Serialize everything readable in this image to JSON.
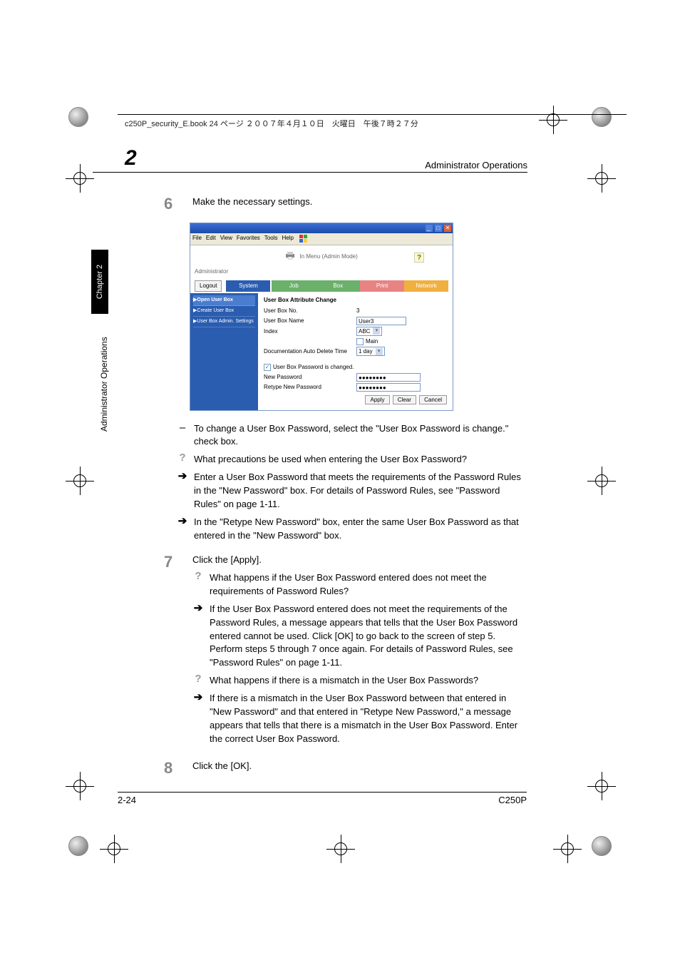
{
  "header_line": "c250P_security_E.book  24 ページ   ２００７年４月１０日　火曜日　午後７時２７分",
  "running_title": "Administrator Operations",
  "chapter_number": "2",
  "side_tab": "Chapter 2",
  "side_label": "Administrator Operations",
  "steps": {
    "s6": {
      "num": "6",
      "text": "Make the necessary settings.",
      "subs": [
        {
          "type": "dash",
          "text": "To change a User Box Password, select the \"User Box Password is change.\" check box."
        },
        {
          "type": "q",
          "text": "What precautions be used when entering the User Box Password?"
        },
        {
          "type": "arrow",
          "text": "Enter a User Box Password that meets the requirements of the Password Rules in the \"New Password\" box. For details of Password Rules, see \"Password Rules\" on page 1-11."
        },
        {
          "type": "arrow",
          "text": "In the \"Retype New Password\" box, enter the same User Box Password as that entered in the \"New Password\" box."
        }
      ]
    },
    "s7": {
      "num": "7",
      "text": "Click the [Apply].",
      "subs": [
        {
          "type": "q",
          "text": "What happens if the User Box Password entered does not meet the requirements of Password Rules?"
        },
        {
          "type": "arrow",
          "text": "If the User Box Password entered does not meet the requirements of the Password Rules, a message appears that tells that the User Box Password entered cannot be used. Click [OK] to go back to the screen of step 5. Perform steps 5 through 7 once again. For details of Password Rules, see \"Password Rules\" on page 1-11."
        },
        {
          "type": "q",
          "text": "What happens if there is a mismatch in the User Box Passwords?"
        },
        {
          "type": "arrow",
          "text": "If there is a mismatch in the User Box Password between that entered in \"New Password\" and that entered in \"Retype New Password,\" a message appears that tells that there is a mismatch in the User Box Password. Enter the correct User Box Password."
        }
      ]
    },
    "s8": {
      "num": "8",
      "text": "Click the [OK]."
    }
  },
  "screenshot": {
    "menubar": [
      "File",
      "Edit",
      "View",
      "Favorites",
      "Tools",
      "Help"
    ],
    "menu_title": "In Menu (Admin Mode)",
    "admin_label": "Administrator",
    "logout": "Logout",
    "tabs": {
      "system": "System",
      "job": "Job",
      "box": "Box",
      "print": "Print",
      "network": "Network"
    },
    "side": {
      "open": "▶Open User Box",
      "create": "▶Create User Box",
      "admin": "▶User Box Admin. Settings"
    },
    "main": {
      "heading": "User Box Attribute Change",
      "box_no_lbl": "User Box No.",
      "box_no_val": "3",
      "box_name_lbl": "User Box Name",
      "box_name_val": "User3",
      "index_lbl": "Index",
      "index_val": "ABC",
      "main_chk_lbl": "Main",
      "auto_del_lbl": "Documentation Auto Delete Time",
      "auto_del_val": "1 day",
      "pw_chk_lbl": "User Box Password is changed.",
      "new_pw_lbl": "New Password",
      "new_pw_val": "●●●●●●●●",
      "retype_pw_lbl": "Retype New Password",
      "retype_pw_val": "●●●●●●●●",
      "btn_apply": "Apply",
      "btn_clear": "Clear",
      "btn_cancel": "Cancel"
    }
  },
  "footer": {
    "left": "2-24",
    "right": "C250P"
  }
}
